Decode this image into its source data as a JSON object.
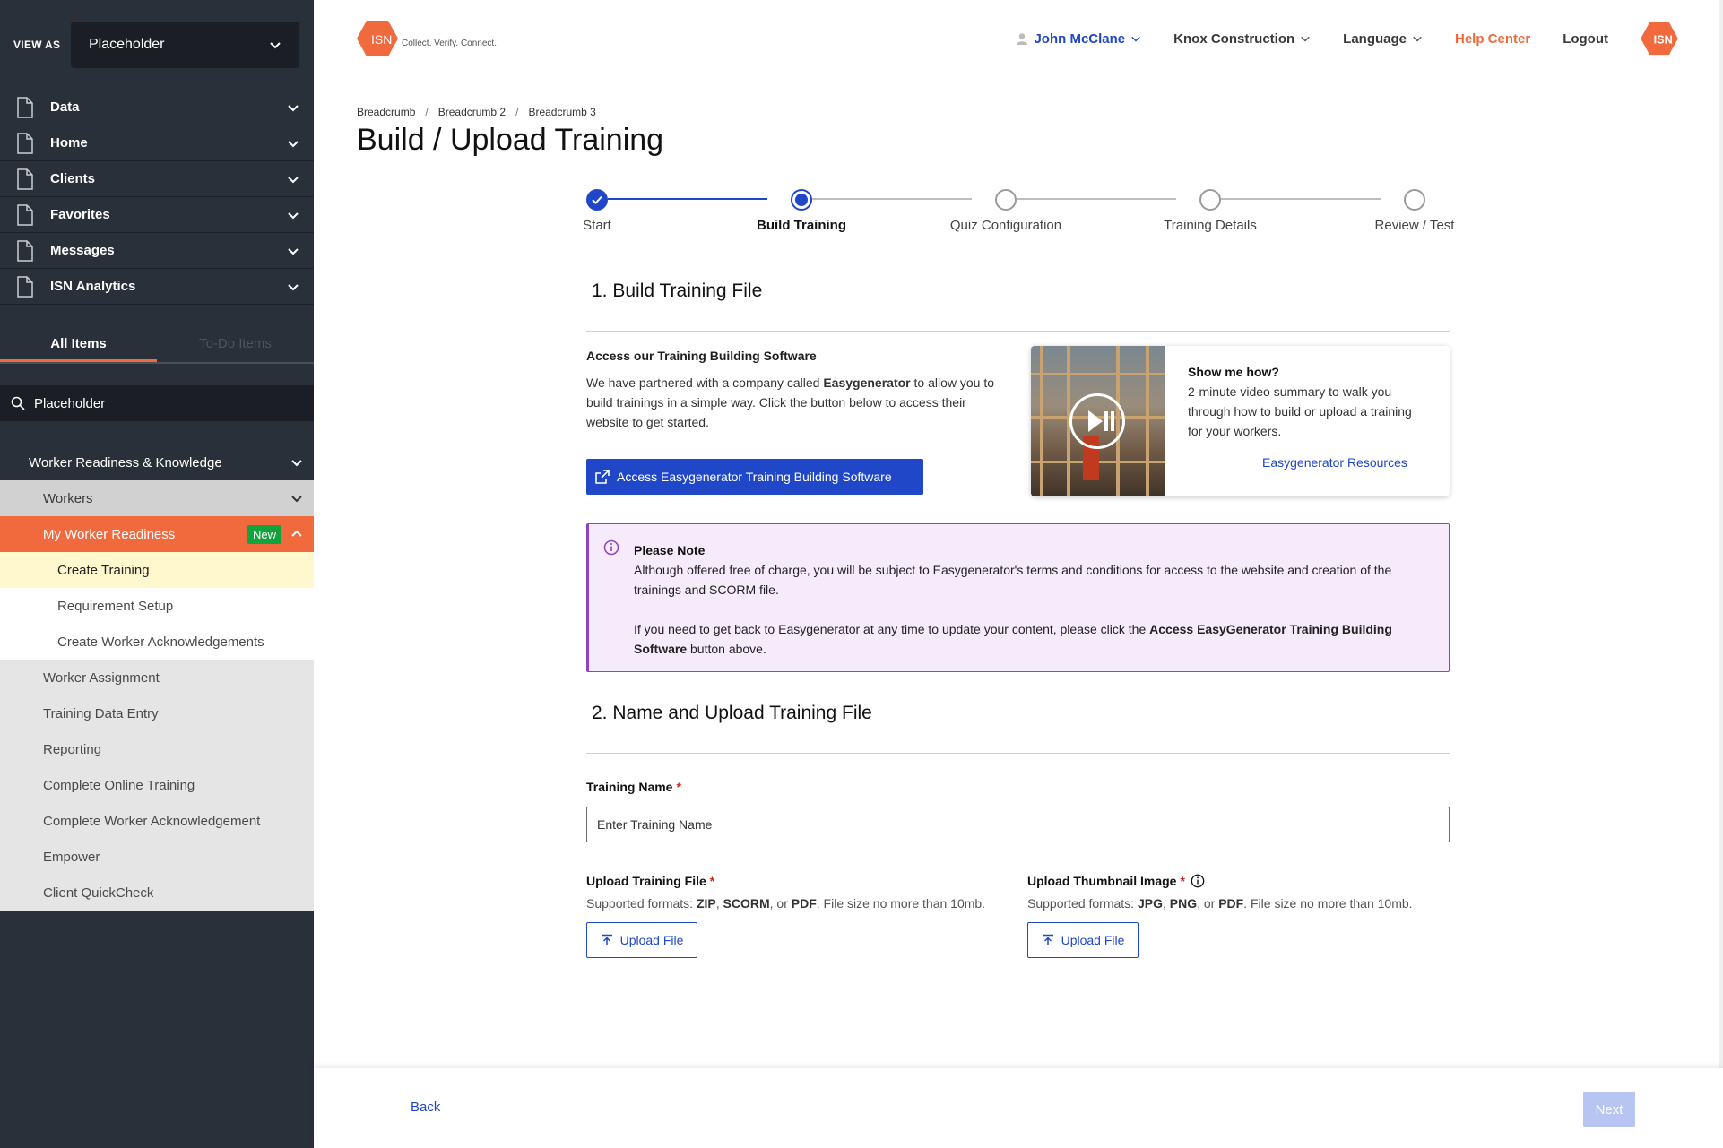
{
  "sidebar": {
    "view_as_label": "VIEW AS",
    "view_as_value": "Placeholder",
    "nav": [
      {
        "label": "Data"
      },
      {
        "label": "Home"
      },
      {
        "label": "Clients"
      },
      {
        "label": "Favorites"
      },
      {
        "label": "Messages"
      },
      {
        "label": "ISN Analytics"
      }
    ],
    "tabs": {
      "all": "All Items",
      "todo": "To-Do Items"
    },
    "search_value": "Placeholder",
    "tree": {
      "group": "Worker Readiness & Knowledge",
      "workers": "Workers",
      "active": "My Worker Readiness",
      "active_badge": "New",
      "subitems": [
        "Create Training",
        "Requirement Setup",
        "Create Worker Acknowledgements"
      ],
      "level2": [
        "Worker Assignment",
        "Training Data Entry",
        "Reporting",
        "Complete Online Training",
        "Complete Worker Acknowledgement",
        "Empower",
        "Client QuickCheck"
      ]
    }
  },
  "header": {
    "logo_text": "ISN",
    "tagline": "Collect. Verify. Connect.",
    "user": "John McClane",
    "company": "Knox Construction",
    "language": "Language",
    "help": "Help Center",
    "logout": "Logout"
  },
  "breadcrumbs": [
    "Breadcrumb",
    "Breadcrumb 2",
    "Breadcrumb 3"
  ],
  "page_title": "Build / Upload Training",
  "steps": [
    {
      "label": "Start",
      "state": "complete"
    },
    {
      "label": "Build Training",
      "state": "current"
    },
    {
      "label": "Quiz Configuration",
      "state": "pending"
    },
    {
      "label": "Training Details",
      "state": "pending"
    },
    {
      "label": "Review / Test",
      "state": "pending"
    }
  ],
  "section1": {
    "title": "1. Build Training File",
    "access_title": "Access our Training Building Software",
    "access_text_1": "We have partnered with a company called ",
    "access_text_bold": "Easygenerator",
    "access_text_2": " to allow you to build trainings in a simple way. Click the button below to access their website to get started.",
    "access_button": "Access Easygenerator Training Building Software",
    "video_title": "Show me how?",
    "video_desc": "2-minute video summary to walk you through how to build or upload a training for your workers.",
    "video_link": "Easygenerator Resources"
  },
  "note": {
    "title": "Please Note",
    "p1": "Although offered free of charge, you will be subject to Easygenerator's terms and conditions for access to the website and creation of the trainings and SCORM file.",
    "p2_a": "If you need to get back to Easygenerator at any time to update your content, please click the ",
    "p2_bold": "Access EasyGenerator Training Building Software",
    "p2_b": " button above."
  },
  "section2": {
    "title": "2. Name and Upload Training File",
    "name_label": "Training Name",
    "required_mark": "*",
    "name_placeholder": "Enter Training Name",
    "file_label": "Upload Training File",
    "file_formats_prefix": "Supported formats: ",
    "file_formats_list": [
      "ZIP",
      "SCORM",
      "PDF"
    ],
    "file_formats_suffix": ". File size no more than 10mb.",
    "thumb_label": "Upload Thumbnail Image",
    "thumb_formats_list": [
      "JPG",
      "PNG",
      "PDF"
    ],
    "sep_comma": ", ",
    "sep_or": ", or ",
    "upload_button": "Upload File"
  },
  "footer": {
    "back": "Back",
    "next": "Next"
  },
  "colors": {
    "brand_orange": "#f06a3e",
    "primary_blue": "#1f47c8",
    "sidebar_bg": "#2a3039",
    "note_purple": "#9142c2"
  }
}
